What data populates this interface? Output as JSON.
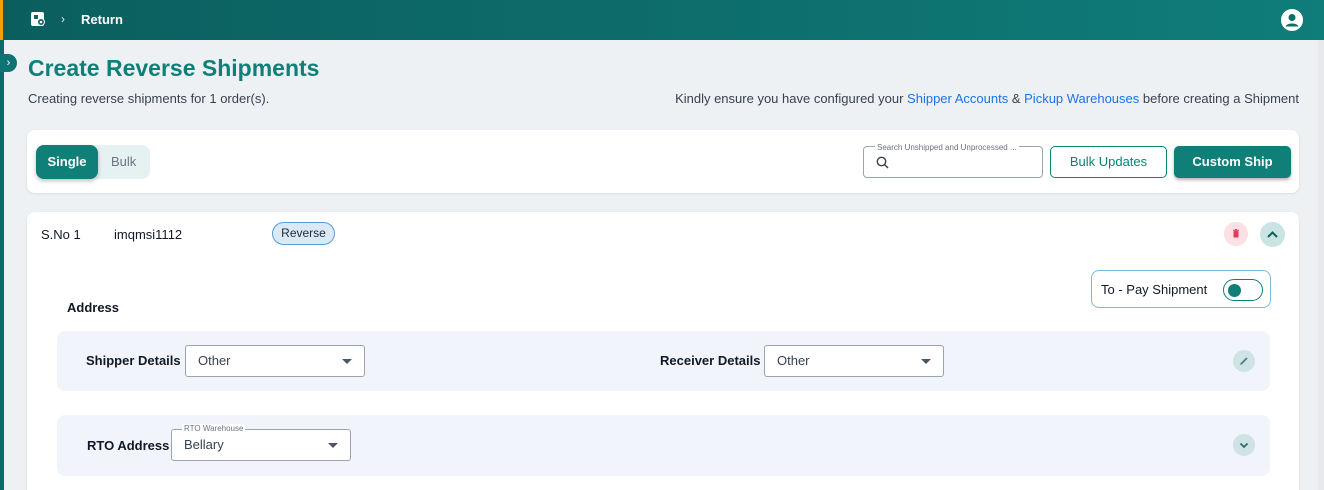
{
  "breadcrumb": {
    "current": "Return"
  },
  "page": {
    "title": "Create Reverse Shipments",
    "subtitle": "Creating reverse shipments for 1 order(s).",
    "notice": {
      "prefix": "Kindly ensure you have configured your ",
      "link1": "Shipper Accounts",
      "middle": " & ",
      "link2": "Pickup Warehouses",
      "suffix": " before creating a Shipment"
    }
  },
  "toolbar": {
    "modes": [
      "Single",
      "Bulk"
    ],
    "active_mode": "Single",
    "search": {
      "label": "Search Unshipped and Unprocessed ...",
      "value": ""
    },
    "bulk_updates_label": "Bulk Updates",
    "custom_ship_label": "Custom Ship"
  },
  "shipment": {
    "sno": "S.No 1",
    "order_id": "imqmsi1112",
    "type_badge": "Reverse",
    "to_pay_label": "To - Pay Shipment",
    "to_pay_enabled": false,
    "address_title": "Address",
    "shipper_label": "Shipper Details",
    "shipper_value": "Other",
    "receiver_label": "Receiver Details",
    "receiver_value": "Other",
    "rto_label": "RTO Address",
    "rto_field_label": "RTO Warehouse",
    "rto_value": "Bellary"
  },
  "icons": {
    "home": "warehouse-icon",
    "user": "account-circle-icon",
    "search": "search-icon",
    "delete": "trash-icon",
    "collapse": "chevron-up-icon",
    "edit": "pencil-icon",
    "expand": "chevron-down-icon"
  },
  "colors": {
    "brand": "#0f7f78",
    "title": "#0f8078",
    "link": "#1a73e8"
  }
}
